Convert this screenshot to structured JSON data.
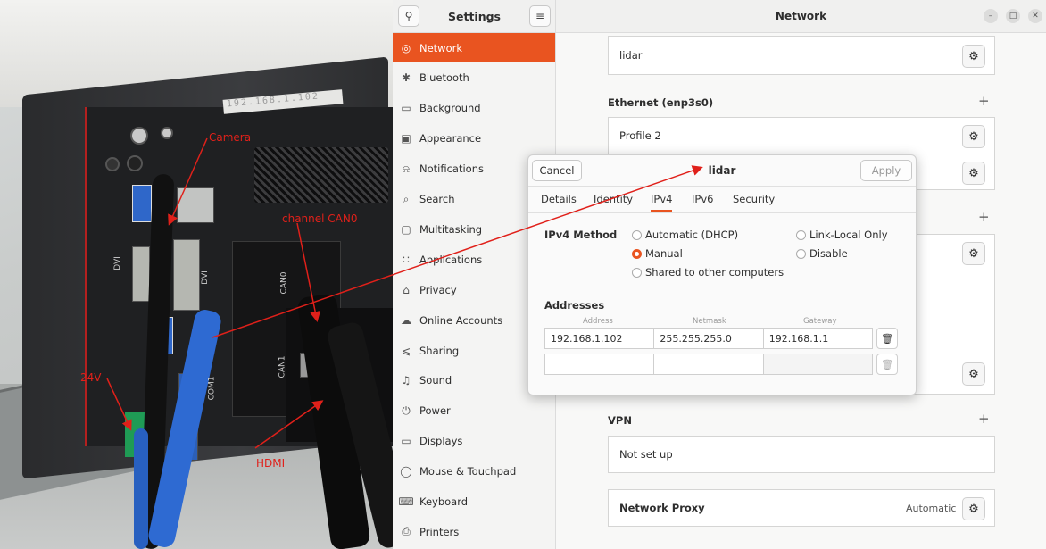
{
  "photo": {
    "label_text": "192.168.1.102",
    "annotations": {
      "camera": "Camera",
      "channel": "channel CAN0",
      "power": "24V",
      "hdmi": "HDMI"
    },
    "printed_labels": [
      "DVI",
      "DVI",
      "CAN0",
      "COM1",
      "CAN1"
    ]
  },
  "sidebar": {
    "title": "Settings",
    "items": [
      {
        "label": "Network",
        "icon": "network-icon"
      },
      {
        "label": "Bluetooth",
        "icon": "bluetooth-icon"
      },
      {
        "label": "Background",
        "icon": "background-icon"
      },
      {
        "label": "Appearance",
        "icon": "appearance-icon"
      },
      {
        "label": "Notifications",
        "icon": "bell-icon"
      },
      {
        "label": "Search",
        "icon": "search-icon"
      },
      {
        "label": "Multitasking",
        "icon": "multitasking-icon"
      },
      {
        "label": "Applications",
        "icon": "apps-grid-icon"
      },
      {
        "label": "Privacy",
        "icon": "lock-icon"
      },
      {
        "label": "Online Accounts",
        "icon": "cloud-icon"
      },
      {
        "label": "Sharing",
        "icon": "share-icon"
      },
      {
        "label": "Sound",
        "icon": "music-note-icon"
      },
      {
        "label": "Power",
        "icon": "power-icon"
      },
      {
        "label": "Displays",
        "icon": "display-icon"
      },
      {
        "label": "Mouse & Touchpad",
        "icon": "mouse-icon"
      },
      {
        "label": "Keyboard",
        "icon": "keyboard-icon"
      },
      {
        "label": "Printers",
        "icon": "printer-icon"
      }
    ],
    "active_index": 0
  },
  "main": {
    "title": "Network",
    "lidar_card": "lidar",
    "ethernet_section": "Ethernet (enp3s0)",
    "profile2": "Profile 2",
    "vpn_section": "VPN",
    "vpn_value": "Not set up",
    "proxy_label": "Network Proxy",
    "proxy_value": "Automatic"
  },
  "dialog": {
    "title": "lidar",
    "cancel": "Cancel",
    "apply": "Apply",
    "tabs": [
      "Details",
      "Identity",
      "IPv4",
      "IPv6",
      "Security"
    ],
    "active_tab": "IPv4",
    "method_label": "IPv4 Method",
    "methods": {
      "automatic": "Automatic (DHCP)",
      "manual": "Manual",
      "shared": "Shared to other computers",
      "link_local": "Link-Local Only",
      "disable": "Disable"
    },
    "selected_method": "manual",
    "addresses_label": "Addresses",
    "columns": [
      "Address",
      "Netmask",
      "Gateway"
    ],
    "rows": [
      {
        "address": "192.168.1.102",
        "netmask": "255.255.255.0",
        "gateway": "192.168.1.1"
      },
      {
        "address": "",
        "netmask": "",
        "gateway": ""
      }
    ]
  },
  "colors": {
    "accent": "#e95420",
    "annotation": "#e0201a"
  }
}
